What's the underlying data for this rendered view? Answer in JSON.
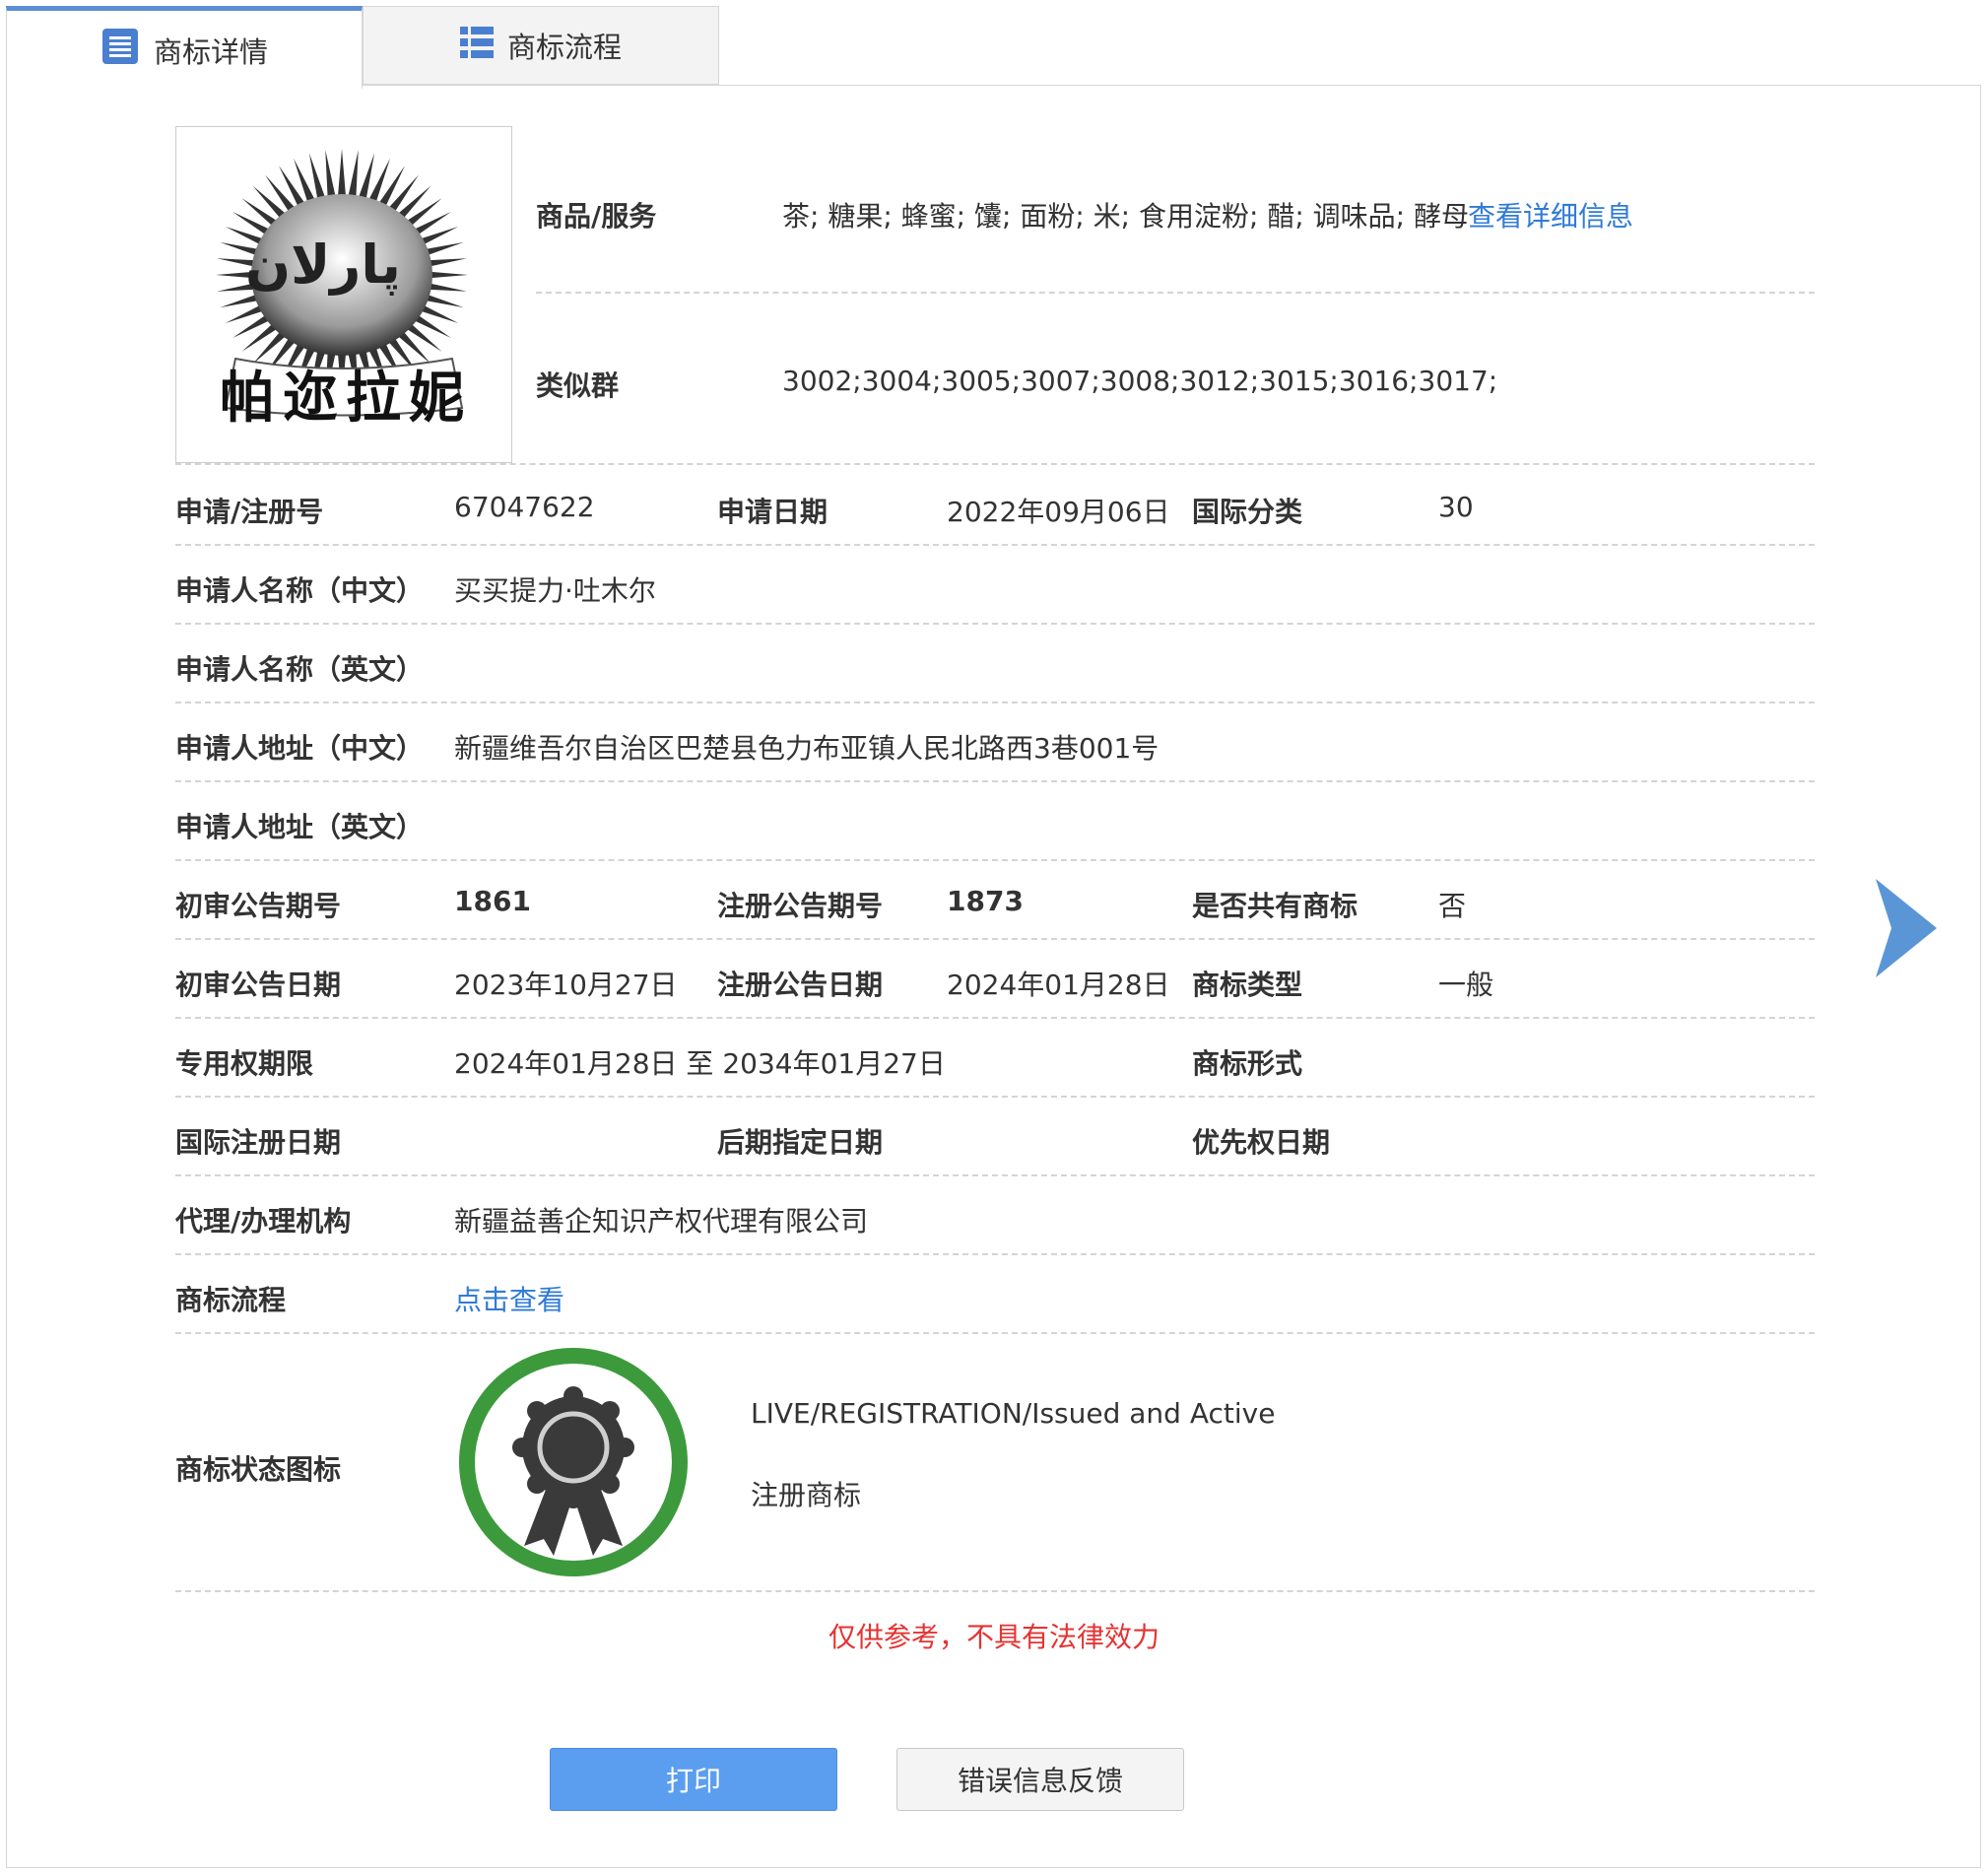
{
  "tabs": [
    {
      "label": "商标详情",
      "icon": "list-doc-icon",
      "active": true
    },
    {
      "label": "商标流程",
      "icon": "grid-list-icon",
      "active": false
    }
  ],
  "logo": {
    "arabic": "پارلان",
    "chinese": "帕迩拉妮"
  },
  "goods": {
    "label": "商品/服务",
    "value": "茶; 糖果; 蜂蜜; 馕; 面粉; 米; 食用淀粉; 醋; 调味品; 酵母",
    "link": "查看详细信息"
  },
  "similar_group": {
    "label": "类似群",
    "value": "3002;3004;3005;3007;3008;3012;3015;3016;3017;"
  },
  "fields": {
    "reg_no": {
      "label": "申请/注册号",
      "value": "67047622"
    },
    "apply_date": {
      "label": "申请日期",
      "value": "2022年09月06日"
    },
    "intl_class": {
      "label": "国际分类",
      "value": "30"
    },
    "applicant_cn": {
      "label": "申请人名称（中文）",
      "value": "买买提力·吐木尔"
    },
    "applicant_en": {
      "label": "申请人名称（英文）",
      "value": ""
    },
    "address_cn": {
      "label": "申请人地址（中文）",
      "value": "新疆维吾尔自治区巴楚县色力布亚镇人民北路西3巷001号"
    },
    "address_en": {
      "label": "申请人地址（英文）",
      "value": ""
    },
    "prelim_issue": {
      "label": "初审公告期号",
      "value": "1861"
    },
    "reg_issue": {
      "label": "注册公告期号",
      "value": "1873"
    },
    "shared": {
      "label": "是否共有商标",
      "value": "否"
    },
    "prelim_date": {
      "label": "初审公告日期",
      "value": "2023年10月27日"
    },
    "reg_date": {
      "label": "注册公告日期",
      "value": "2024年01月28日"
    },
    "mark_type": {
      "label": "商标类型",
      "value": "一般"
    },
    "exclusive_period": {
      "label": "专用权期限",
      "value": "2024年01月28日 至 2034年01月27日"
    },
    "mark_form": {
      "label": "商标形式",
      "value": ""
    },
    "intl_reg_date": {
      "label": "国际注册日期",
      "value": ""
    },
    "later_designation": {
      "label": "后期指定日期",
      "value": ""
    },
    "priority_date": {
      "label": "优先权日期",
      "value": ""
    },
    "agency": {
      "label": "代理/办理机构",
      "value": "新疆益善企知识产权代理有限公司"
    },
    "process": {
      "label": "商标流程",
      "value": "点击查看"
    },
    "status_icon": {
      "label": "商标状态图标",
      "status_en": "LIVE/REGISTRATION/Issued and Active",
      "status_cn": "注册商标"
    }
  },
  "notice": "仅供参考，不具有法律效力",
  "buttons": {
    "print": "打印",
    "feedback": "错误信息反馈"
  },
  "colors": {
    "accent": "#5b9ef0",
    "link": "#2f7bd6",
    "notice": "#e53333",
    "badge_ring": "#3c9a3c"
  }
}
